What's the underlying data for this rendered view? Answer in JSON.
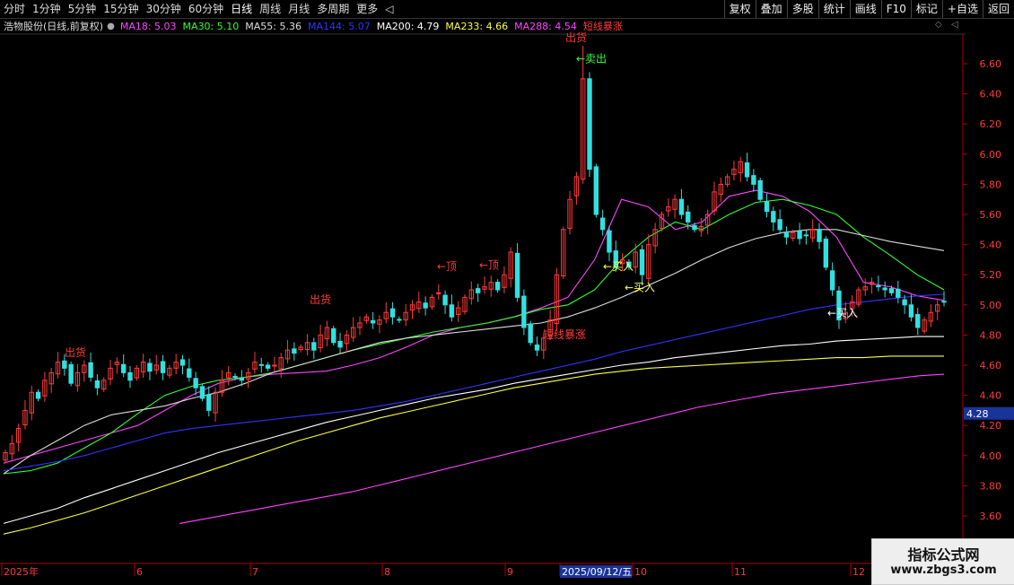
{
  "toolbar": {
    "tabs": [
      {
        "label": "分时",
        "active": false
      },
      {
        "label": "1分钟",
        "active": false
      },
      {
        "label": "5分钟",
        "active": false
      },
      {
        "label": "15分钟",
        "active": false
      },
      {
        "label": "30分钟",
        "active": false
      },
      {
        "label": "60分钟",
        "active": false
      },
      {
        "label": "日线",
        "active": true
      },
      {
        "label": "周线",
        "active": false
      },
      {
        "label": "月线",
        "active": false
      },
      {
        "label": "多周期",
        "active": false
      },
      {
        "label": "更多",
        "active": false
      }
    ],
    "tools": [
      "复权",
      "叠加",
      "多股",
      "统计",
      "画线",
      "F10",
      "标记",
      "+自选",
      "返回"
    ]
  },
  "legend": {
    "title": "浩物股份(日线,前复权)",
    "ma": [
      {
        "name": "MA18",
        "value": "5.03",
        "color": "#ff44ff"
      },
      {
        "name": "MA30",
        "value": "5.10",
        "color": "#33ff33"
      },
      {
        "name": "MA55",
        "value": "5.36",
        "color": "#dddddd"
      },
      {
        "name": "MA144",
        "value": "5.07",
        "color": "#3333ff"
      },
      {
        "name": "MA200",
        "value": "4.79",
        "color": "#ffffff"
      },
      {
        "name": "MA233",
        "value": "4.66",
        "color": "#ffff44"
      },
      {
        "name": "MA288",
        "value": "4.54",
        "color": "#ff44ff"
      }
    ],
    "signal": "短线暴涨"
  },
  "watermark": {
    "line1": "指标公式网",
    "line2": "www.zbgs3.com"
  },
  "chart_data": {
    "type": "candlestick",
    "ylim": [
      3.5,
      6.75
    ],
    "yticks": [
      "6.60",
      "6.40",
      "6.20",
      "6.00",
      "5.80",
      "5.60",
      "5.40",
      "5.20",
      "5.00",
      "4.80",
      "4.60",
      "4.40",
      "4.20",
      "4.00",
      "3.80",
      "3.60"
    ],
    "current_price_label": "4.28",
    "current_price": 4.28,
    "xaxis_labels": [
      "2025年",
      "6",
      "7",
      "8",
      "9",
      "2025/09/12/五",
      "10",
      "11",
      "12"
    ],
    "annotations": [
      {
        "text": "出货",
        "price": 4.66,
        "color": "#ff3b3b"
      },
      {
        "text": "出货",
        "price": 5.01,
        "color": "#ff3b3b"
      },
      {
        "text": "←顶",
        "price": 5.23,
        "color": "#ff3b3b"
      },
      {
        "text": "←顶",
        "price": 5.24,
        "color": "#ff3b3b"
      },
      {
        "text": "短线暴涨",
        "price": 4.78,
        "color": "#ff3b3b"
      },
      {
        "text": "出货",
        "price": 6.75,
        "color": "#ff3b3b"
      },
      {
        "text": "←卖出",
        "price": 6.61,
        "color": "#33ff33"
      },
      {
        "text": "←买入",
        "price": 5.23,
        "color": "#ffff44"
      },
      {
        "text": "←买入",
        "price": 5.09,
        "color": "#ffff44"
      },
      {
        "text": "←买入",
        "price": 4.92,
        "color": "#ffffff"
      }
    ],
    "closes": [
      4.02,
      4.08,
      4.18,
      4.3,
      4.42,
      4.38,
      4.5,
      4.55,
      4.62,
      4.58,
      4.48,
      4.55,
      4.6,
      4.52,
      4.45,
      4.5,
      4.58,
      4.62,
      4.55,
      4.5,
      4.58,
      4.62,
      4.56,
      4.6,
      4.55,
      4.58,
      4.62,
      4.6,
      4.52,
      4.45,
      4.38,
      4.3,
      4.42,
      4.5,
      4.55,
      4.52,
      4.5,
      4.55,
      4.62,
      4.6,
      4.58,
      4.6,
      4.65,
      4.7,
      4.68,
      4.72,
      4.75,
      4.7,
      4.8,
      4.85,
      4.75,
      4.72,
      4.8,
      4.85,
      4.88,
      4.92,
      4.88,
      4.9,
      4.95,
      4.92,
      4.9,
      4.95,
      5.0,
      5.02,
      4.98,
      5.05,
      5.08,
      5.0,
      4.92,
      4.98,
      5.05,
      5.1,
      5.08,
      5.12,
      5.15,
      5.1,
      5.2,
      5.35,
      5.05,
      4.85,
      4.75,
      4.7,
      4.78,
      4.9,
      5.2,
      5.5,
      5.7,
      5.85,
      6.5,
      5.9,
      5.6,
      5.5,
      5.35,
      5.25,
      5.3,
      5.25,
      5.35,
      5.2,
      5.4,
      5.5,
      5.6,
      5.65,
      5.7,
      5.6,
      5.55,
      5.5,
      5.52,
      5.6,
      5.75,
      5.8,
      5.85,
      5.9,
      5.95,
      5.85,
      5.8,
      5.7,
      5.62,
      5.55,
      5.5,
      5.45,
      5.48,
      5.44,
      5.46,
      5.5,
      5.42,
      5.25,
      5.1,
      4.9,
      4.95,
      5.02,
      5.1,
      5.12,
      5.15,
      5.12,
      5.1,
      5.08,
      5.05,
      5.0,
      4.92,
      4.85,
      4.9,
      4.95,
      5.0,
      5.02
    ],
    "series": [
      {
        "name": "MA18",
        "color": "#ff44ff",
        "values": [
          3.95,
          4.0,
          4.05,
          4.1,
          4.15,
          4.2,
          4.3,
          4.4,
          4.48,
          4.52,
          4.54,
          4.55,
          4.56,
          4.6,
          4.65,
          4.72,
          4.8,
          4.85,
          4.88,
          4.92,
          4.98,
          5.05,
          5.3,
          5.7,
          5.65,
          5.5,
          5.55,
          5.72,
          5.76,
          5.72,
          5.62,
          5.45,
          5.15,
          5.12,
          5.06,
          5.03
        ]
      },
      {
        "name": "MA30",
        "color": "#33ff33",
        "values": [
          3.88,
          3.9,
          3.95,
          4.05,
          4.15,
          4.28,
          4.4,
          4.46,
          4.5,
          4.52,
          4.55,
          4.6,
          4.65,
          4.7,
          4.74,
          4.78,
          4.82,
          4.85,
          4.88,
          4.92,
          4.97,
          5.0,
          5.1,
          5.3,
          5.45,
          5.55,
          5.5,
          5.6,
          5.68,
          5.7,
          5.66,
          5.6,
          5.45,
          5.33,
          5.2,
          5.1
        ]
      },
      {
        "name": "MA55",
        "color": "#dddddd",
        "values": [
          3.88,
          4.0,
          4.1,
          4.2,
          4.27,
          4.3,
          4.33,
          4.38,
          4.42,
          4.48,
          4.55,
          4.6,
          4.65,
          4.7,
          4.75,
          4.78,
          4.8,
          4.82,
          4.84,
          4.86,
          4.88,
          4.92,
          4.98,
          5.05,
          5.13,
          5.21,
          5.3,
          5.38,
          5.44,
          5.48,
          5.5,
          5.5,
          5.46,
          5.42,
          5.39,
          5.36
        ]
      },
      {
        "name": "MA144",
        "color": "#3333ff",
        "values": [
          3.9,
          3.93,
          3.96,
          4.0,
          4.05,
          4.1,
          4.15,
          4.18,
          4.2,
          4.22,
          4.24,
          4.26,
          4.28,
          4.3,
          4.33,
          4.36,
          4.4,
          4.44,
          4.48,
          4.52,
          4.56,
          4.6,
          4.64,
          4.69,
          4.73,
          4.77,
          4.81,
          4.85,
          4.89,
          4.93,
          4.97,
          5.0,
          5.02,
          5.04,
          5.06,
          5.07
        ]
      },
      {
        "name": "MA200",
        "color": "#ffffff",
        "values": [
          3.55,
          3.6,
          3.65,
          3.72,
          3.78,
          3.84,
          3.9,
          3.96,
          4.02,
          4.07,
          4.12,
          4.17,
          4.22,
          4.26,
          4.3,
          4.34,
          4.38,
          4.41,
          4.44,
          4.48,
          4.51,
          4.54,
          4.57,
          4.6,
          4.62,
          4.65,
          4.67,
          4.69,
          4.71,
          4.73,
          4.74,
          4.76,
          4.77,
          4.78,
          4.79,
          4.79
        ]
      },
      {
        "name": "MA233",
        "color": "#ffff44",
        "values": [
          3.48,
          3.52,
          3.57,
          3.62,
          3.68,
          3.74,
          3.8,
          3.86,
          3.92,
          3.98,
          4.04,
          4.1,
          4.15,
          4.2,
          4.25,
          4.29,
          4.33,
          4.37,
          4.41,
          4.45,
          4.48,
          4.51,
          4.54,
          4.56,
          4.58,
          4.59,
          4.6,
          4.61,
          4.62,
          4.63,
          4.64,
          4.65,
          4.65,
          4.66,
          4.66,
          4.66
        ]
      },
      {
        "name": "MA288",
        "color": "#ff44ff",
        "values": [
          3.55,
          3.58,
          3.61,
          3.64,
          3.67,
          3.7,
          3.73,
          3.76,
          3.8,
          3.84,
          3.88,
          3.92,
          3.96,
          4.0,
          4.04,
          4.08,
          4.12,
          4.16,
          4.2,
          4.24,
          4.28,
          4.32,
          4.35,
          4.38,
          4.41,
          4.43,
          4.45,
          4.47,
          4.49,
          4.51,
          4.53,
          4.54
        ]
      }
    ]
  }
}
